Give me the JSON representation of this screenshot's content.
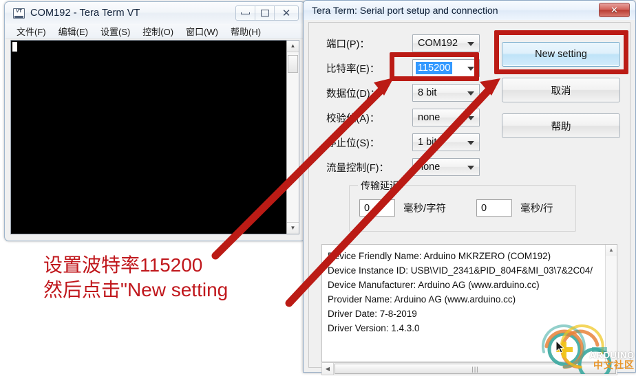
{
  "terminal_window": {
    "title": "COM192 - Tera Term VT",
    "icon": "vt-terminal-icon",
    "caption_buttons": {
      "minimize": "minimize-icon",
      "maximize": "maximize-icon",
      "close": "close-icon",
      "close_glyph": "✕"
    },
    "menu": [
      {
        "label": "文件(F)"
      },
      {
        "label": "编辑(E)"
      },
      {
        "label": "设置(S)"
      },
      {
        "label": "控制(O)"
      },
      {
        "label": "窗口(W)"
      },
      {
        "label": "帮助(H)"
      }
    ],
    "screen_text": "",
    "scroll_up_glyph": "▲",
    "scroll_down_glyph": "▼"
  },
  "dialog": {
    "title": "Tera Term: Serial port setup and connection",
    "close_glyph": "✕",
    "fields": [
      {
        "label": "端口(P)：",
        "value": "COM192",
        "name": "port"
      },
      {
        "label": "比特率(E)：",
        "value": "115200",
        "name": "baud-rate"
      },
      {
        "label": "数据位(D)：",
        "value": "8 bit",
        "name": "data-bits"
      },
      {
        "label": "校验位(A)：",
        "value": "none",
        "name": "parity"
      },
      {
        "label": "停止位(S)：",
        "value": "1 bit",
        "name": "stop-bits"
      },
      {
        "label": "流量控制(F)：",
        "value": "none",
        "name": "flow-control"
      }
    ],
    "transmit_delay": {
      "legend": "传输延迟",
      "char_value": "0",
      "char_unit": "毫秒/字符",
      "line_value": "0",
      "line_unit": "毫秒/行"
    },
    "buttons": {
      "new_setting": "New setting",
      "cancel": "取消",
      "help": "帮助"
    },
    "device_info": [
      "Device Friendly Name: Arduino MKRZERO (COM192)",
      "Device Instance ID: USB\\VID_2341&PID_804F&MI_03\\7&2C04/",
      "Device Manufacturer: Arduino AG (www.arduino.cc)",
      "Provider Name: Arduino AG (www.arduino.cc)",
      "Driver Date: 7-8-2019",
      "Driver Version: 1.4.3.0"
    ],
    "scroll_up_glyph": "▲",
    "hscroll_left_glyph": "◀",
    "hscroll_grip": "|||"
  },
  "annotation": {
    "line1": "设置波特率115200",
    "line2": "然后点击\"New setting",
    "color": "#c0171c",
    "highlight_box_color": "#bb1b15"
  },
  "watermark": {
    "brand": "ARDUINO",
    "community": "中文社区",
    "colors": {
      "teal": "#3aa9a0",
      "orange": "#e8823a",
      "yellow": "#f0c419"
    }
  }
}
